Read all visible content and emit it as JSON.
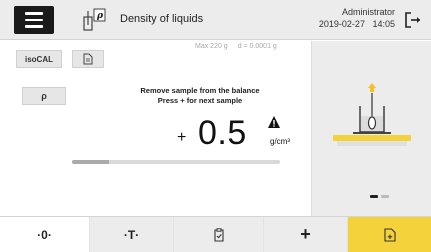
{
  "titlebar": {
    "title": "Density of liquids",
    "app_icon_symbol": "ρ",
    "user_name": "Administrator",
    "date": "2019-02-27",
    "time": "14:05"
  },
  "toolbar": {
    "isocal_label": "isoCAL",
    "rho_label": "ρ"
  },
  "balance": {
    "max": "Max 220 g",
    "readability": "d = 0.0001 g"
  },
  "instruction": {
    "line1": "Remove sample from the balance",
    "line2": "Press + for next sample"
  },
  "reading": {
    "sign": "+",
    "value": "0.5",
    "unit": "g/cm³",
    "stability_progress": 0.18
  },
  "bottom_bar": {
    "zero_label": "·0·",
    "tare_label": "·T·",
    "add_label": "+"
  },
  "colors": {
    "accent": "#f4d23c",
    "dot_active": "#222222",
    "dot_inactive": "#bbbbbb"
  }
}
